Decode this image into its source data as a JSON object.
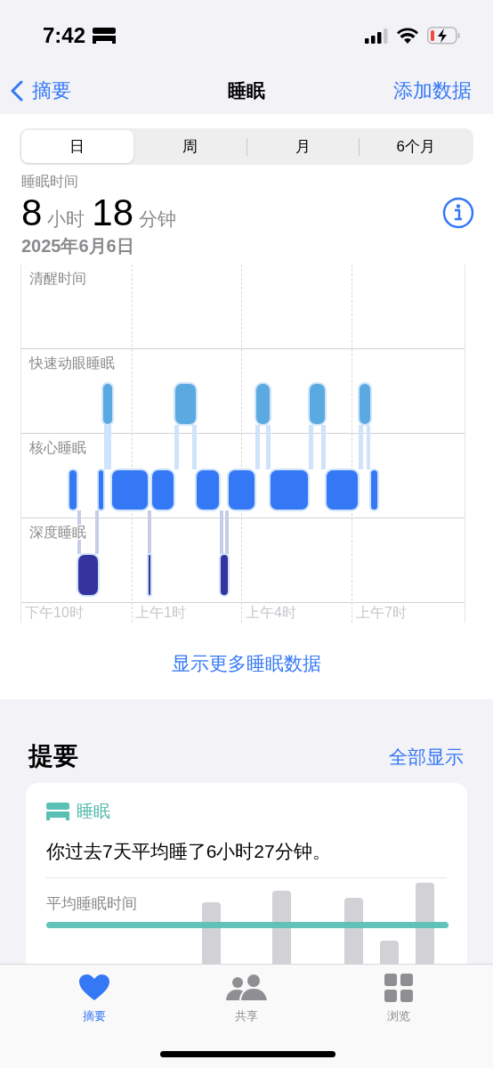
{
  "status_bar": {
    "time": "7:42"
  },
  "nav": {
    "back": "摘要",
    "title": "睡眠",
    "action": "添加数据"
  },
  "tabs": [
    {
      "label": "日",
      "selected": true
    },
    {
      "label": "周",
      "selected": false
    },
    {
      "label": "月",
      "selected": false
    },
    {
      "label": "6个月",
      "selected": false
    }
  ],
  "summary": {
    "label": "睡眠时间",
    "hours": "8",
    "hours_unit": "小时",
    "minutes": "18",
    "minutes_unit": "分钟",
    "date": "2025年6月6日"
  },
  "chart": {
    "stages": [
      "清醒时间",
      "快速动眼睡眠",
      "核心睡眠",
      "深度睡眠"
    ],
    "time_labels": [
      "下午10时",
      "上午1时",
      "上午4时",
      "上午7时"
    ]
  },
  "more_link": "显示更多睡眠数据",
  "highlights": {
    "title": "提要",
    "show_all": "全部显示",
    "card": {
      "category": "睡眠",
      "text": "你过去7天平均睡了6小时27分钟。",
      "chart_label": "平均睡眠时间"
    }
  },
  "tab_bar": [
    {
      "kind": "heart",
      "label": "摘要",
      "selected": true
    },
    {
      "kind": "people",
      "label": "共享",
      "selected": false
    },
    {
      "kind": "grid",
      "label": "浏览",
      "selected": false
    }
  ]
}
